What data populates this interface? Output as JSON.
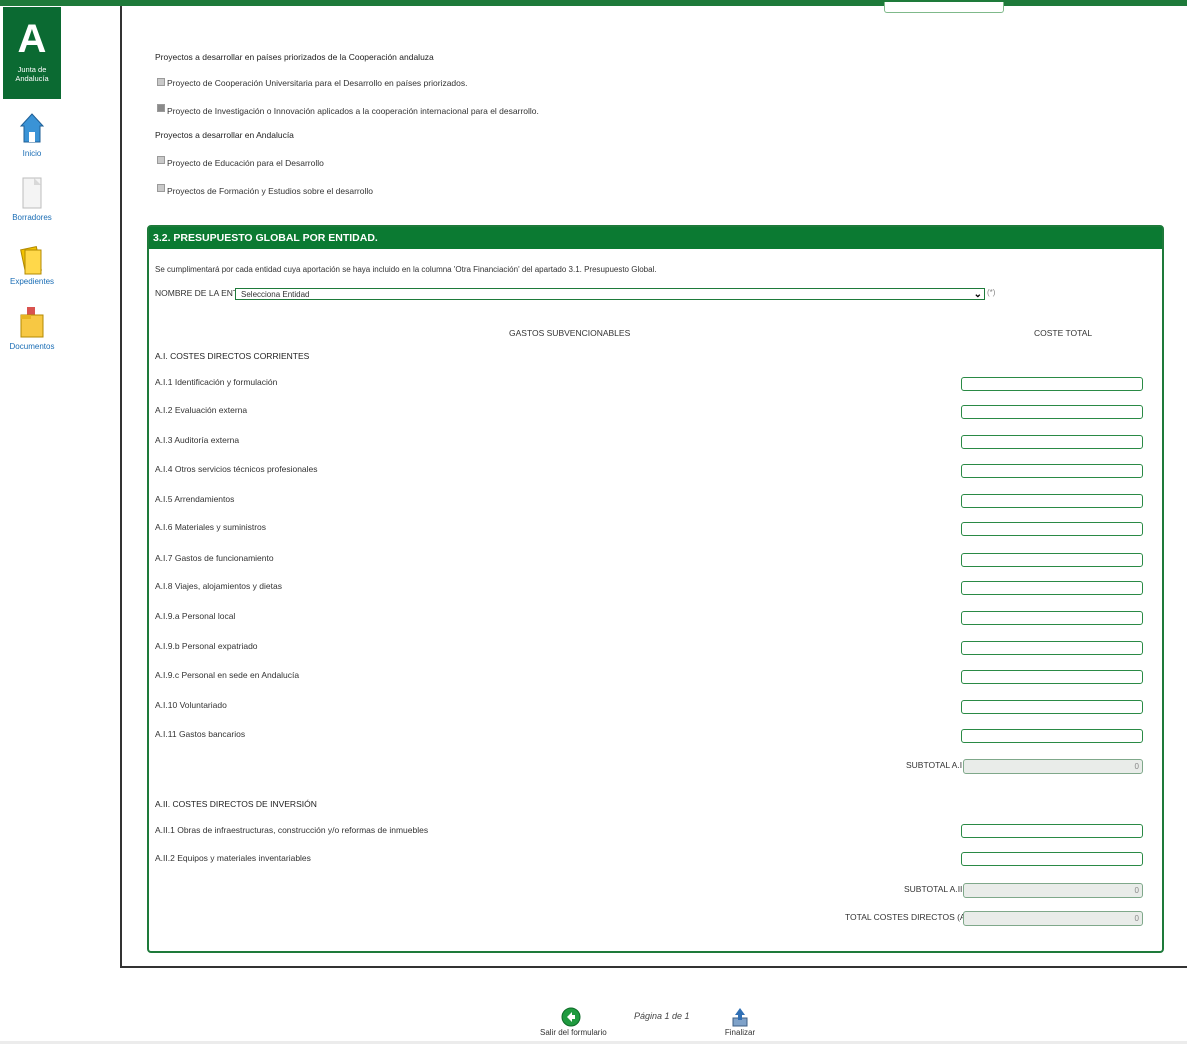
{
  "colors": {
    "brand_green": "#0b6a32",
    "header_green": "#0b7a32",
    "link_blue": "#1a6db5"
  },
  "sidebar": {
    "logo_glyph": "A",
    "logo_text": "Junta de Andalucía",
    "items": [
      {
        "label": "Inicio",
        "icon": "home-icon"
      },
      {
        "label": "Borradores",
        "icon": "draft-document-icon"
      },
      {
        "label": "Expedientes",
        "icon": "folder-icon"
      },
      {
        "label": "Documentos",
        "icon": "documents-folder-icon"
      }
    ]
  },
  "projects": {
    "group1_title": "Proyectos a desarrollar en países priorizados de la Cooperación andaluza",
    "group1_items": [
      {
        "label": "Proyecto de Cooperación Universitaria para el Desarrollo en países priorizados.",
        "checked": false
      },
      {
        "label": "Proyecto de Investigación o Innovación aplicados a la cooperación internacional para el desarrollo.",
        "checked": true
      }
    ],
    "group2_title": "Proyectos a desarrollar en Andalucía",
    "group2_items": [
      {
        "label": "Proyecto de Educación para el Desarrollo",
        "checked": false
      },
      {
        "label": "Proyectos de Formación y Estudios sobre el desarrollo",
        "checked": false
      }
    ]
  },
  "section": {
    "title": "3.2. PRESUPUESTO GLOBAL POR ENTIDAD.",
    "instruction": "Se cumplimentará por cada entidad cuya aportación se haya incluido en la columna 'Otra Financiación' del apartado 3.1. Presupuesto Global.",
    "entity_label": "NOMBRE DE LA ENTIDAD",
    "entity_value": "Selecciona Entidad",
    "required_mark": "(*)",
    "col_gastos": "GASTOS SUBVENCIONABLES",
    "col_coste": "COSTE TOTAL",
    "group_a1_title": "A.I. COSTES DIRECTOS CORRIENTES",
    "a1_rows": [
      "A.I.1 Identificación y formulación",
      "A.I.2 Evaluación externa",
      "A.I.3 Auditoría externa",
      "A.I.4 Otros servicios técnicos profesionales",
      "A.I.5 Arrendamientos",
      "A.I.6 Materiales y suministros",
      "A.I.7 Gastos de funcionamiento",
      "A.I.8 Viajes, alojamientos y dietas",
      "A.I.9.a Personal local",
      "A.I.9.b Personal expatriado",
      "A.I.9.c Personal en sede en Andalucía",
      "A.I.10 Voluntariado",
      "A.I.11 Gastos bancarios"
    ],
    "subtotal_a1_label": "SUBTOTAL A.I",
    "subtotal_a1_value": "0",
    "group_a2_title": "A.II. COSTES DIRECTOS DE INVERSIÓN",
    "a2_rows": [
      "A.II.1 Obras de infraestructuras, construcción y/o reformas de inmuebles",
      "A.II.2 Equipos y materiales inventariables"
    ],
    "subtotal_a2_label": "SUBTOTAL A.II",
    "subtotal_a2_value": "0",
    "total_label": "TOTAL COSTES DIRECTOS (A.I + A.II)",
    "total_value": "0"
  },
  "footer": {
    "exit_label": "Salir del formulario",
    "page_indicator": "Página 1 de 1",
    "finish_label": "Finalizar"
  }
}
